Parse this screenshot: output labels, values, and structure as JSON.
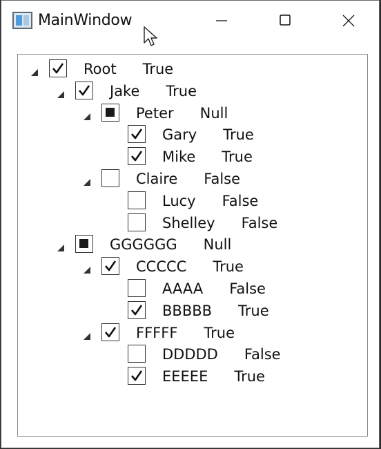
{
  "window": {
    "title": "MainWindow"
  },
  "tree": [
    {
      "name": "Root",
      "state": "True",
      "check": "checked",
      "expanded": true,
      "level": 0
    },
    {
      "name": "Jake",
      "state": "True",
      "check": "checked",
      "expanded": true,
      "level": 1
    },
    {
      "name": "Peter",
      "state": "Null",
      "check": "indeterminate",
      "expanded": true,
      "level": 2
    },
    {
      "name": "Gary",
      "state": "True",
      "check": "checked",
      "expanded": null,
      "level": 3
    },
    {
      "name": "Mike",
      "state": "True",
      "check": "checked",
      "expanded": null,
      "level": 3
    },
    {
      "name": "Claire",
      "state": "False",
      "check": "unchecked",
      "expanded": true,
      "level": 2
    },
    {
      "name": "Lucy",
      "state": "False",
      "check": "unchecked",
      "expanded": null,
      "level": 3
    },
    {
      "name": "Shelley",
      "state": "False",
      "check": "unchecked",
      "expanded": null,
      "level": 3
    },
    {
      "name": "GGGGGG",
      "state": "Null",
      "check": "indeterminate",
      "expanded": true,
      "level": 1
    },
    {
      "name": "CCCCC",
      "state": "True",
      "check": "checked",
      "expanded": true,
      "level": 2
    },
    {
      "name": "AAAA",
      "state": "False",
      "check": "unchecked",
      "expanded": null,
      "level": 3
    },
    {
      "name": "BBBBB",
      "state": "True",
      "check": "checked",
      "expanded": null,
      "level": 3
    },
    {
      "name": "FFFFF",
      "state": "True",
      "check": "checked",
      "expanded": true,
      "level": 2
    },
    {
      "name": "DDDDD",
      "state": "False",
      "check": "unchecked",
      "expanded": null,
      "level": 3
    },
    {
      "name": "EEEEE",
      "state": "True",
      "check": "checked",
      "expanded": null,
      "level": 3
    }
  ]
}
